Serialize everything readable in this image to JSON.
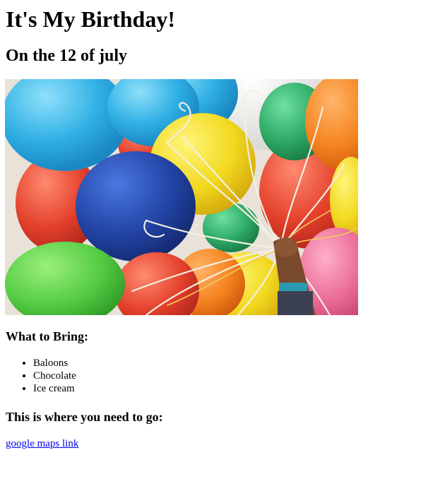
{
  "header": {
    "title": "It's My Birthday!",
    "date": "On the 12 of july"
  },
  "hero_image": {
    "subject": "colorful balloons held by a hand",
    "colors": {
      "sky_blue": "#3fb8e6",
      "deep_blue": "#2847a8",
      "yellow": "#f5dc2a",
      "red": "#e8432f",
      "orange": "#f58a22",
      "green": "#5cd34a",
      "pink": "#ec6f9a",
      "teal_green": "#2fae67"
    }
  },
  "bring_section": {
    "heading": "What to Bring:",
    "items": [
      "Baloons",
      "Chocolate",
      "Ice cream"
    ]
  },
  "location_section": {
    "heading": "This is where you need to go:",
    "link_text": "google maps link"
  }
}
